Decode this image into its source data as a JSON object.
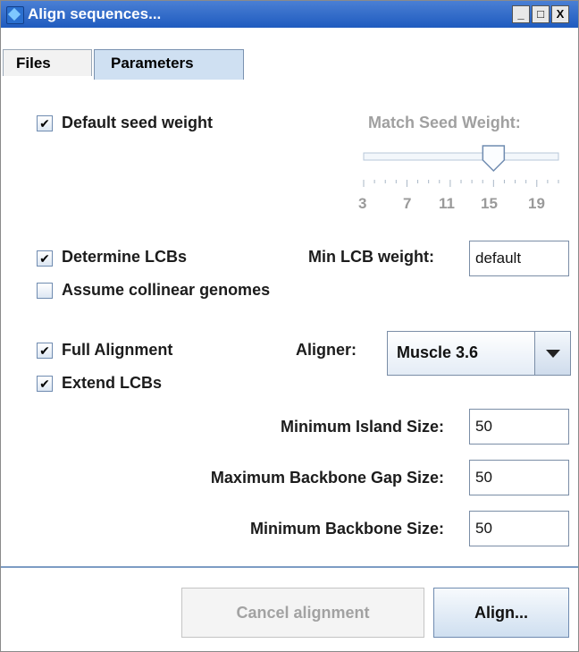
{
  "window": {
    "title": "Align sequences...",
    "min_glyph": "_",
    "max_glyph": "□",
    "close_glyph": "X"
  },
  "tabs": [
    {
      "label": "Files",
      "selected": false
    },
    {
      "label": "Parameters",
      "selected": true
    }
  ],
  "seed": {
    "default_label": "Default seed weight",
    "default_checked": true,
    "slider_label": "Match Seed Weight:",
    "slider_value": 15,
    "slider_min": 3,
    "slider_max": 21,
    "tick_labels": [
      "3",
      "7",
      "11",
      "15",
      "19"
    ],
    "enabled": false
  },
  "lcb": {
    "determine_label": "Determine LCBs",
    "determine_checked": true,
    "min_weight_label": "Min LCB weight:",
    "min_weight_value": "default",
    "collinear_label": "Assume collinear genomes",
    "collinear_checked": false
  },
  "alignment": {
    "full_label": "Full Alignment",
    "full_checked": true,
    "extend_label": "Extend LCBs",
    "extend_checked": true,
    "aligner_label": "Aligner:",
    "aligner_value": "Muscle 3.6"
  },
  "sizes": {
    "min_island_label": "Minimum Island Size:",
    "min_island_value": "50",
    "max_gap_label": "Maximum Backbone Gap Size:",
    "max_gap_value": "50",
    "min_backbone_label": "Minimum Backbone Size:",
    "min_backbone_value": "50"
  },
  "buttons": {
    "cancel_label": "Cancel alignment",
    "cancel_enabled": false,
    "align_label": "Align..."
  },
  "check_glyph": "✔",
  "colors": {
    "title_bar": "#2a63c6",
    "tab_selected": "#cfe0f2",
    "accent_line": "#7d9cc4",
    "disabled_text": "#a0a0a0"
  }
}
